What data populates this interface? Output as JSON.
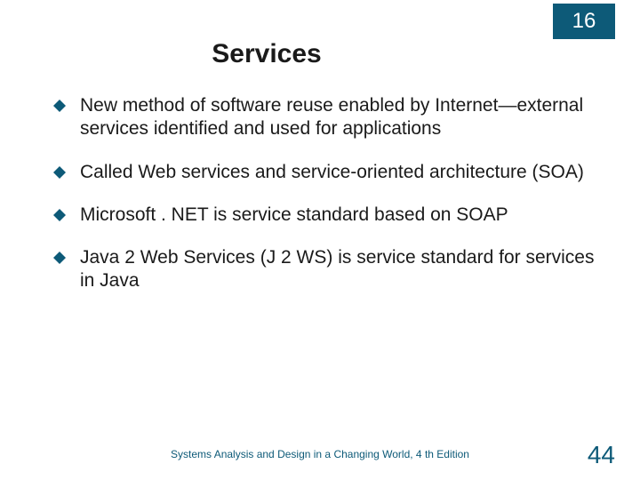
{
  "chapter": "16",
  "title": "Services",
  "bullets": [
    "New method of software reuse enabled by Internet—external services identified and used for applications",
    "Called Web services and service-oriented architecture (SOA)",
    "Microsoft . NET is service standard based on SOAP",
    "Java 2 Web Services (J 2 WS) is service standard for services in Java"
  ],
  "footer": "Systems Analysis and Design in a Changing World, 4 th Edition",
  "page_number": "44",
  "colors": {
    "accent": "#0d5a78"
  }
}
